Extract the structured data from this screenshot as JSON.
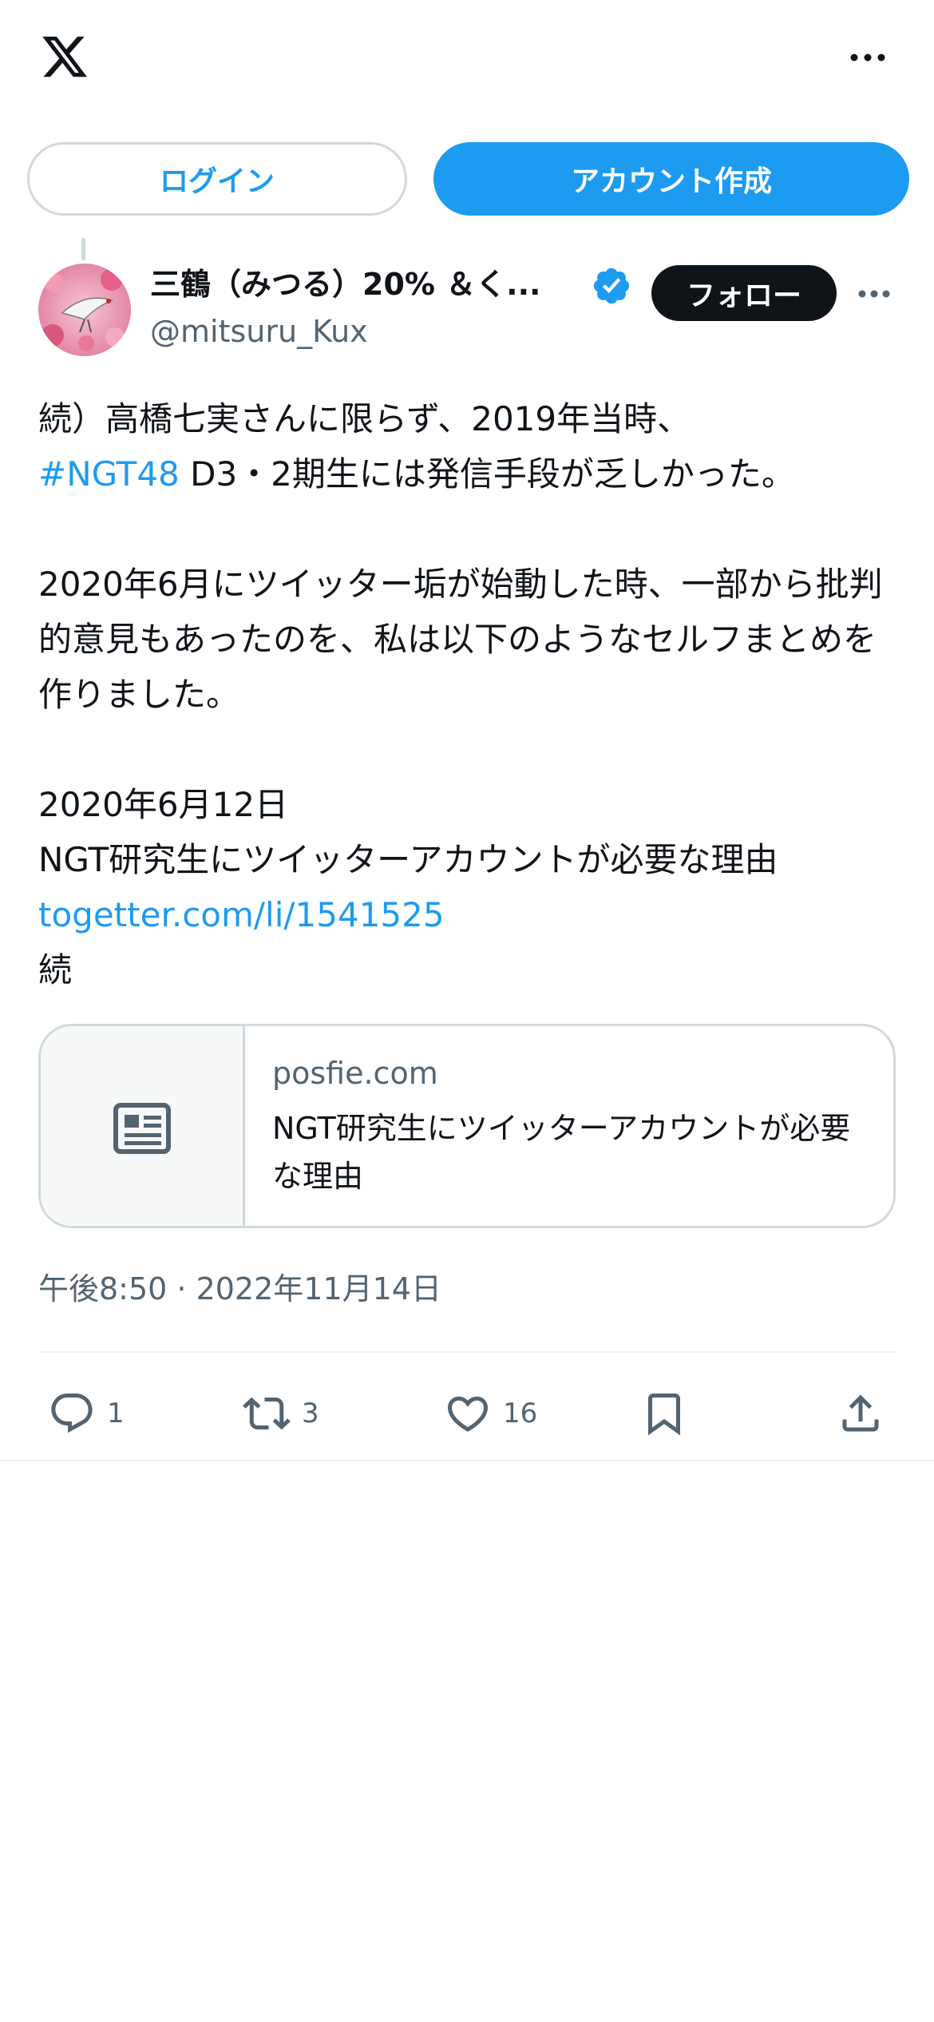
{
  "header": {
    "logo_icon": "x-logo-icon",
    "more_icon": "more-dots-icon"
  },
  "auth": {
    "login_label": "ログイン",
    "signup_label": "アカウント作成"
  },
  "tweet": {
    "author_name": "三鶴（みつる）20% ＆く...",
    "handle": "@mitsuru_Kux",
    "verified_icon": "verified-badge-icon",
    "follow_label": "フォロー",
    "text_line1": "続）高橋七実さんに限らず、2019年当時、",
    "hashtag": "#NGT48",
    "text_line2_rest": " D3・2期生には発信手段が乏しかった。",
    "text_para2": "2020年6月にツイッター垢が始動した時、一部から批判的意見もあったのを、私は以下のようなセルフまとめを作りました。",
    "text_date": "2020年6月12日",
    "text_title": "NGT研究生にツイッターアカウントが必要な理由",
    "link": "togetter.com/li/1541525",
    "text_end": "続",
    "timestamp": "午後8:50 · 2022年11月14日"
  },
  "card": {
    "domain": "posfie.com",
    "title": "NGT研究生にツイッターアカウントが必要な理由",
    "thumb_icon": "article-icon"
  },
  "actions": {
    "reply_count": "1",
    "retweet_count": "3",
    "like_count": "16"
  },
  "colors": {
    "accent": "#1d9bf0",
    "text": "#0f1419",
    "secondary": "#536471",
    "border": "#cfd9de"
  }
}
